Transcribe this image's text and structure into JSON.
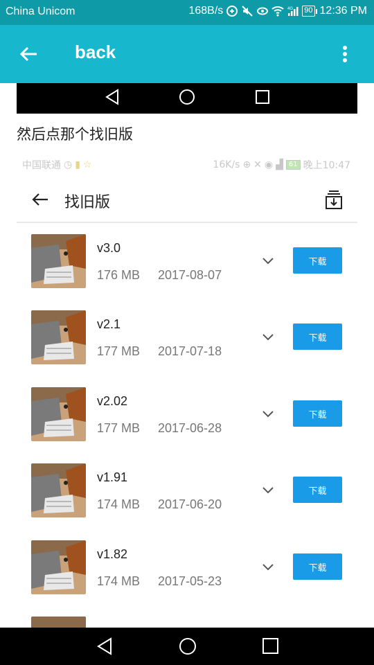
{
  "status_bar": {
    "carrier": "China Unicom",
    "speed": "168B/s",
    "battery": "90",
    "time": "12:36 PM",
    "network": "4G"
  },
  "app_bar": {
    "back_icon": "arrow-left-icon",
    "title": "back",
    "more_icon": "more-vertical-icon"
  },
  "post": {
    "caption": "然后点那个找旧版"
  },
  "inner_screenshot": {
    "status": {
      "carrier": "中国联通",
      "speed": "16K/s",
      "battery": "61",
      "time": "晚上10:47"
    },
    "header": {
      "title": "找旧版",
      "download_icon": "download-tray-icon"
    },
    "versions": [
      {
        "version": "v3.0",
        "size": "176 MB",
        "date": "2017-08-07",
        "button": "下载"
      },
      {
        "version": "v2.1",
        "size": "177 MB",
        "date": "2017-07-18",
        "button": "下载"
      },
      {
        "version": "v2.02",
        "size": "177 MB",
        "date": "2017-06-28",
        "button": "下载"
      },
      {
        "version": "v1.91",
        "size": "174 MB",
        "date": "2017-06-20",
        "button": "下载"
      },
      {
        "version": "v1.82",
        "size": "174 MB",
        "date": "2017-05-23",
        "button": "下载"
      }
    ]
  },
  "colors": {
    "status_bar": "#0f9aa8",
    "app_bar": "#17b7ce",
    "download_button": "#1a9be8"
  }
}
